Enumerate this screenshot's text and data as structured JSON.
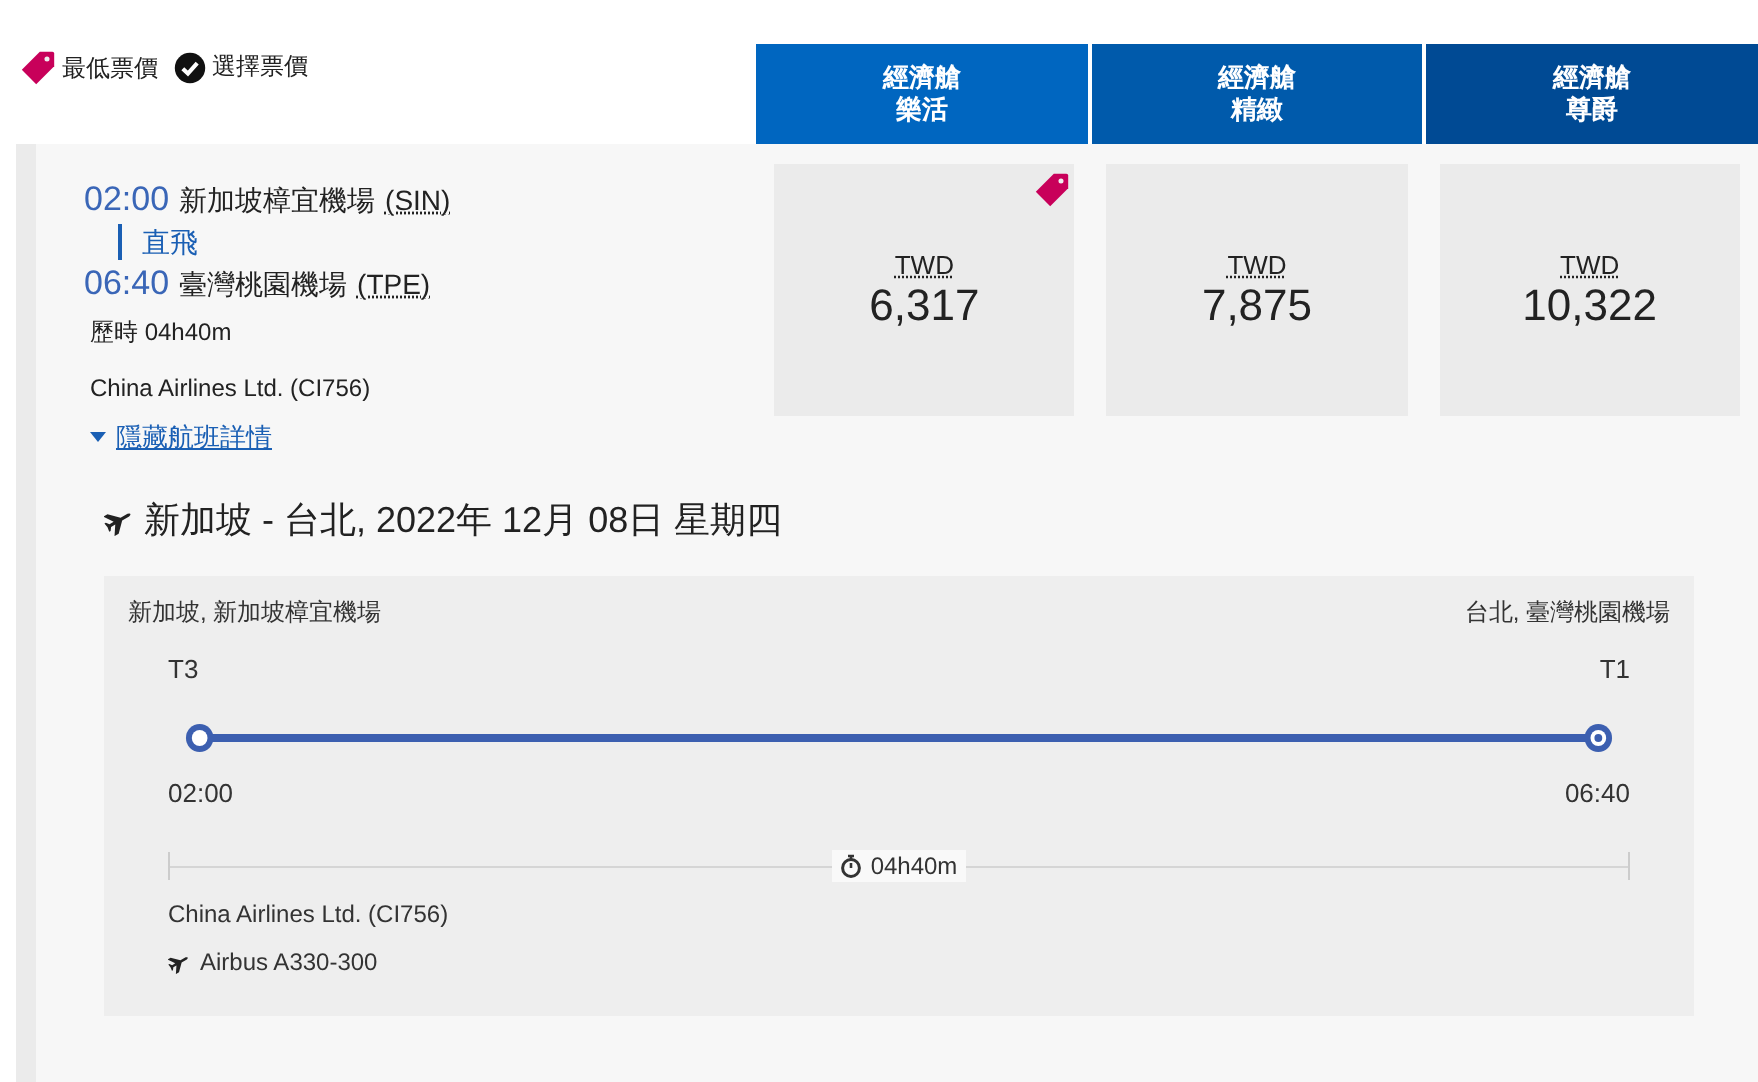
{
  "legend": [
    {
      "kind": "tag",
      "label": "最低票價"
    },
    {
      "kind": "check",
      "label": "選擇票價"
    }
  ],
  "fare_columns": [
    {
      "lines": [
        "經濟艙",
        "樂活"
      ],
      "currency": "TWD",
      "amount": "6,317",
      "lowest": true
    },
    {
      "lines": [
        "經濟艙",
        "精緻"
      ],
      "currency": "TWD",
      "amount": "7,875",
      "lowest": false
    },
    {
      "lines": [
        "經濟艙",
        "尊爵"
      ],
      "currency": "TWD",
      "amount": "10,322",
      "lowest": false
    }
  ],
  "flight": {
    "depart_time": "02:00",
    "depart_airport": "新加坡樟宜機場",
    "depart_code": "(SIN)",
    "stops": "直飛",
    "arrive_time": "06:40",
    "arrive_airport": "臺灣桃園機場",
    "arrive_code": "(TPE)",
    "duration": "歷時 04h40m",
    "carrier": "China Airlines Ltd. (CI756)",
    "toggle": "隱藏航班詳情",
    "expanded": true
  },
  "details": {
    "title": "新加坡 - 台北, 2022年 12月 08日 星期四",
    "origin": "新加坡, 新加坡樟宜機場",
    "destination": "台北, 臺灣桃園機場",
    "origin_terminal": "T3",
    "destination_terminal": "T1",
    "depart": "02:00",
    "arrive": "06:40",
    "duration": "04h40m",
    "carrier": "China Airlines Ltd. (CI756)",
    "aircraft": "Airbus A330-300"
  }
}
